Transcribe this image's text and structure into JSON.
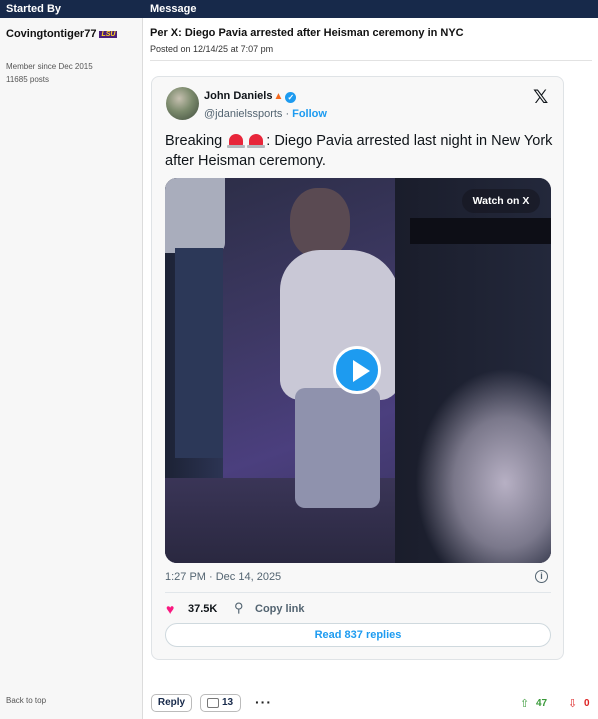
{
  "header": {
    "started_by": "Started By",
    "message": "Message"
  },
  "author": {
    "username": "Covingtontiger77",
    "flair": "LSU",
    "member_since": "Member since Dec 2015",
    "posts": "11685 posts"
  },
  "post": {
    "title": "Per X: Diego Pavia arrested after Heisman ceremony in NYC",
    "posted": "Posted on 12/14/25 at 7:07 pm"
  },
  "tweet": {
    "display_name": "John Daniels",
    "handle": "@jdanielssports",
    "dot": "·",
    "follow": "Follow",
    "x_logo": "𝕏",
    "text_before": "Breaking",
    "text_after": ":  Diego Pavia arrested last night in New York after Heisman ceremony.",
    "watch_label": "Watch on X",
    "timestamp": "1:27 PM · Dec 14, 2025",
    "info": "i",
    "likes": "37.5K",
    "copy_link": "Copy link",
    "read_replies": "Read 837 replies"
  },
  "actions": {
    "reply": "Reply",
    "comments": "13",
    "more": "···",
    "upvotes": "47",
    "downvotes": "0"
  },
  "footer": {
    "back_to_top": "Back to top"
  },
  "colors": {
    "header_bg": "#17294a",
    "x_blue": "#1d9bf0",
    "like_pink": "#f91880",
    "up_green": "#3a9a3a",
    "down_red": "#dd2222"
  }
}
